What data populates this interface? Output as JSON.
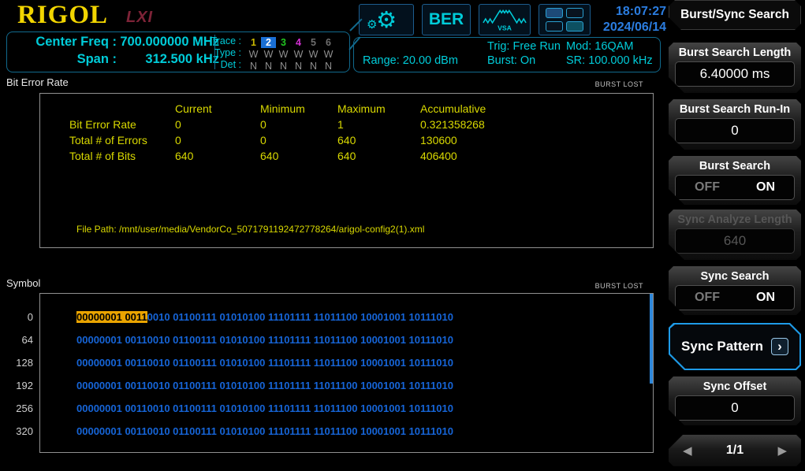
{
  "brand": {
    "logo": "RIGOL",
    "lxi": "LXI"
  },
  "colors": {
    "accent_cyan": "#00ccd9",
    "data_blue": "#1665d8",
    "table_yellow": "#d9d900",
    "highlight_orange": "#eaa400",
    "selected_blue": "#1e9be8",
    "time_blue": "#2b7de0"
  },
  "header": {
    "center_freq_label": "Center Freq :",
    "center_freq_value": "700.000000 MHz",
    "span_label": "Span :",
    "span_value": "312.500 kHz",
    "trace_label": "Trace :",
    "traces": [
      "1",
      "2",
      "3",
      "4",
      "5",
      "6"
    ],
    "type_label": "Type :",
    "types": [
      "W",
      "W",
      "W",
      "W",
      "W",
      "W"
    ],
    "det_label": "Det :",
    "dets": [
      "N",
      "N",
      "N",
      "N",
      "N",
      "N"
    ],
    "range": "Range: 20.00 dBm",
    "trig": "Trig: Free Run",
    "burst": "Burst: On",
    "mod": "Mod: 16QAM",
    "sr": "SR: 100.000 kHz",
    "time": "18:07:27",
    "date": "2024/06/14",
    "ber_button": "BER",
    "vsa_label": "VSA"
  },
  "icons": {
    "gear": "⚙",
    "prev": "◀",
    "next": "▶",
    "submenu_arrow": "›"
  },
  "ber": {
    "section_title": "Bit Error Rate",
    "burst_lost": "BURST LOST",
    "columns": [
      "Current",
      "Minimum",
      "Maximum",
      "Accumulative"
    ],
    "rows": [
      {
        "label": "Bit Error Rate",
        "current": "0",
        "minimum": "0",
        "maximum": "1",
        "accumulative": "0.321358268"
      },
      {
        "label": "Total # of Errors",
        "current": "0",
        "minimum": "0",
        "maximum": "640",
        "accumulative": "130600"
      },
      {
        "label": "Total # of Bits",
        "current": "640",
        "minimum": "640",
        "maximum": "640",
        "accumulative": "406400"
      }
    ],
    "file_path": "File Path: /mnt/user/media/VendorCo_5071791192472778264/arigol-config2(1).xml"
  },
  "symbol": {
    "section_title": "Symbol",
    "burst_lost": "BURST LOST",
    "rows": [
      {
        "index": "0",
        "highlight": "00000001 0011",
        "rest": "0010 01100111 01010100 11101111 11011100 10001001 10111010"
      },
      {
        "index": "64",
        "data": "00000001 00110010 01100111 01010100 11101111 11011100 10001001 10111010"
      },
      {
        "index": "128",
        "data": "00000001 00110010 01100111 01010100 11101111 11011100 10001001 10111010"
      },
      {
        "index": "192",
        "data": "00000001 00110010 01100111 01010100 11101111 11011100 10001001 10111010"
      },
      {
        "index": "256",
        "data": "00000001 00110010 01100111 01010100 11101111 11011100 10001001 10111010"
      },
      {
        "index": "320",
        "data": "00000001 00110010 01100111 01010100 11101111 11011100 10001001 10111010"
      }
    ]
  },
  "menu": {
    "title": "Burst/Sync Search",
    "burst_search_length": {
      "label": "Burst Search Length",
      "value": "6.40000 ms"
    },
    "burst_search_run_in": {
      "label": "Burst Search Run-In",
      "value": "0"
    },
    "burst_search": {
      "label": "Burst Search",
      "off": "OFF",
      "on": "ON"
    },
    "sync_analyze_length": {
      "label": "Sync Analyze Length",
      "value": "640"
    },
    "sync_search": {
      "label": "Sync Search",
      "off": "OFF",
      "on": "ON"
    },
    "sync_pattern": {
      "label": "Sync Pattern"
    },
    "sync_offset": {
      "label": "Sync Offset",
      "value": "0"
    },
    "page": {
      "label": "1/1"
    }
  }
}
